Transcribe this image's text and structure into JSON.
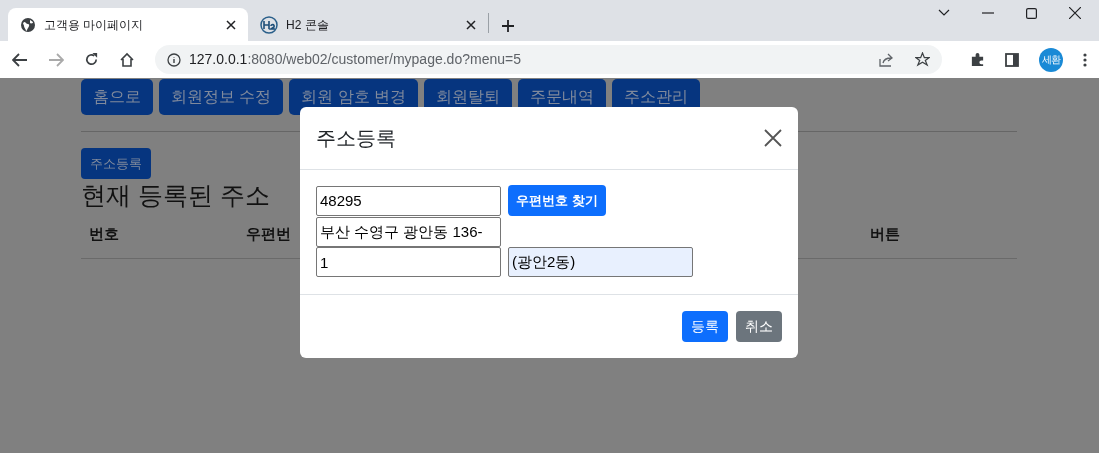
{
  "browser": {
    "tabs": [
      {
        "title": "고객용 마이페이지",
        "selected": true
      },
      {
        "title": "H2 콘솔",
        "selected": false
      }
    ],
    "url_host": "127.0.0.1",
    "url_rest": ":8080/web02/customer/mypage.do?menu=5",
    "profile": "세환"
  },
  "nav": [
    "홈으로",
    "회원정보 수정",
    "회원 암호 변경",
    "회원탈퇴",
    "주문내역",
    "주소관리"
  ],
  "add_button": "주소등록",
  "heading": "현재 등록된 주소",
  "table": {
    "columns": [
      {
        "label": "번호"
      },
      {
        "label": "우편번"
      },
      {
        "label": "버튼"
      }
    ]
  },
  "modal": {
    "title": "주소등록",
    "zipcode": "48295",
    "find_button": "우편번호 찾기",
    "address": "부산 수영구 광안동 136-",
    "detail": "1",
    "extra": "(광안2동)",
    "submit": "등록",
    "cancel": "취소"
  }
}
